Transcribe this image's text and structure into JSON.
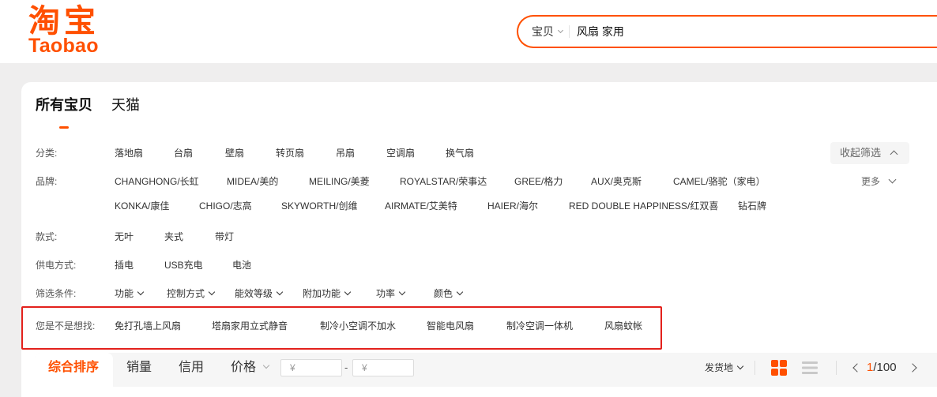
{
  "logo": {
    "cn": "淘宝",
    "en": "Taobao"
  },
  "search": {
    "scope": "宝贝",
    "query": "风扇 家用"
  },
  "tabs": [
    {
      "label": "所有宝贝",
      "active": true
    },
    {
      "label": "天猫",
      "active": false
    }
  ],
  "filters": {
    "collapse_label": "收起筛选",
    "category": {
      "label": "分类:",
      "items": [
        "落地扇",
        "台扇",
        "壁扇",
        "转页扇",
        "吊扇",
        "空调扇",
        "换气扇"
      ]
    },
    "brand": {
      "label": "品牌:",
      "items": [
        "CHANGHONG/长虹",
        "MIDEA/美的",
        "MEILING/美菱",
        "ROYALSTAR/荣事达",
        "GREE/格力",
        "AUX/奥克斯",
        "CAMEL/骆驼（家电）",
        "KONKA/康佳",
        "CHIGO/志高",
        "SKYWORTH/创维",
        "AIRMATE/艾美特",
        "HAIER/海尔",
        "RED DOUBLE HAPPINESS/红双喜",
        "钻石牌"
      ],
      "more_label": "更多"
    },
    "style": {
      "label": "款式:",
      "items": [
        "无叶",
        "夹式",
        "带灯"
      ]
    },
    "power_supply": {
      "label": "供电方式:",
      "items": [
        "插电",
        "USB充电",
        "电池"
      ]
    },
    "conditions": {
      "label": "筛选条件:",
      "dropdowns": [
        "功能",
        "控制方式",
        "能效等级",
        "附加功能",
        "功率",
        "颜色"
      ]
    },
    "suggestions": {
      "label": "您是不是想找:",
      "items": [
        "免打孔墙上风扇",
        "塔扇家用立式静音",
        "制冷小空调不加水",
        "智能电风扇",
        "制冷空调一体机",
        "风扇蚊帐"
      ]
    }
  },
  "sort": {
    "options": [
      {
        "label": "综合排序",
        "active": true
      },
      {
        "label": "销量",
        "active": false
      },
      {
        "label": "信用",
        "active": false
      },
      {
        "label": "价格",
        "active": false
      }
    ],
    "price_min_placeholder": "¥",
    "price_separator": "-",
    "price_max_placeholder": "¥",
    "ship_from": "发货地",
    "grid_view_active": true,
    "view_icons": [
      "grid-view-icon",
      "list-view-icon"
    ]
  },
  "pagination": {
    "current": "1",
    "separator": "/",
    "total": "100"
  },
  "colors": {
    "accent": "#ff5000",
    "highlight_box": "#e3211c",
    "text": "#333333",
    "muted": "#666666",
    "page_bg": "#efeeee"
  }
}
